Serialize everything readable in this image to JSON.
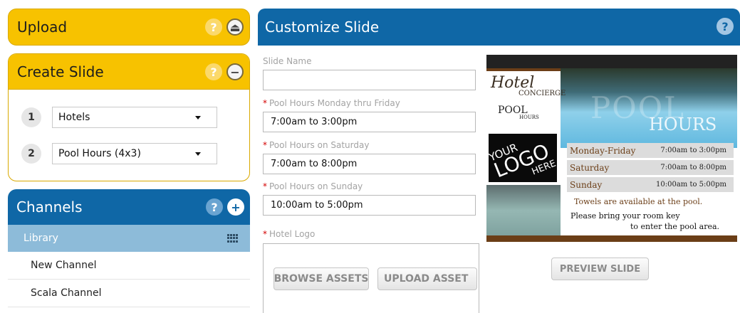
{
  "upload": {
    "title": "Upload",
    "help_glyph": "?",
    "action_glyph": "⏏"
  },
  "create": {
    "title": "Create Slide",
    "help_glyph": "?",
    "action_glyph": "−",
    "steps": [
      {
        "number": "1",
        "value": "Hotels"
      },
      {
        "number": "2",
        "value": "Pool Hours (4x3)"
      }
    ]
  },
  "channels": {
    "title": "Channels",
    "help_glyph": "?",
    "action_glyph": "+",
    "library_label": "Library",
    "items": [
      "New Channel",
      "Scala Channel"
    ]
  },
  "customize": {
    "title": "Customize Slide",
    "help_glyph": "?",
    "fields": {
      "slide_name": {
        "label": "Slide Name",
        "value": ""
      },
      "mon_fri": {
        "label": "Pool Hours Monday thru Friday",
        "value": "7:00am to 3:00pm"
      },
      "saturday": {
        "label": "Pool Hours on Saturday",
        "value": "7:00am to 8:00pm"
      },
      "sunday": {
        "label": "Pool Hours on Sunday",
        "value": "10:00am to 5:00pm"
      },
      "hotel_logo": {
        "label": "Hotel Logo"
      }
    },
    "required_mark": "*",
    "browse_button": "BROWSE ASSETS",
    "upload_button": "UPLOAD ASSET",
    "preview_button": "PREVIEW SLIDE"
  },
  "preview": {
    "brand_script": "Hotel",
    "brand_sub": "CONCIERGE",
    "pool_small": "POOL",
    "hours_small": "HOURS",
    "logo_line1": "YOUR",
    "logo_line2": "LOGO",
    "logo_line3": "HERE",
    "big_pool": "POOL",
    "big_hours": "HOURS",
    "schedule": [
      {
        "day": "Monday-Friday",
        "time": "7:00am to 3:00pm"
      },
      {
        "day": "Saturday",
        "time": "7:00am to 8:00pm"
      },
      {
        "day": "Sunday",
        "time": "10:00am to 5:00pm"
      }
    ],
    "note1": "Towels are available at the pool.",
    "note2": "Please bring your room key",
    "note3": "to enter the pool area."
  },
  "colors": {
    "yellow_header": "#f7c200",
    "blue_header": "#0f67a6",
    "library_row": "#8dbbd9",
    "required": "#d40000",
    "brown_accent": "#6b3e17"
  }
}
